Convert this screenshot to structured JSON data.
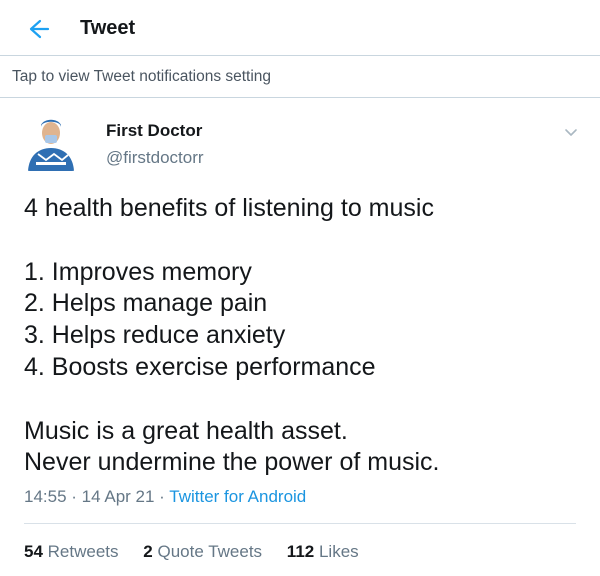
{
  "header": {
    "title": "Tweet",
    "back_icon": "back-arrow-icon",
    "accent_color": "#1da1f2"
  },
  "notification_bar": {
    "text": "Tap to view Tweet notifications setting"
  },
  "tweet": {
    "author_name": "First Doctor",
    "author_handle": "@firstdoctorr",
    "avatar_icon": "doctor-avatar",
    "menu_icon": "chevron-down-icon",
    "text": "4 health benefits of listening to music\n\n1. Improves memory\n2. Helps manage pain\n3. Helps reduce anxiety\n4. Boosts exercise performance\n\nMusic is a great health asset.\nNever undermine the power of music.",
    "time": "14:55",
    "separator": " · ",
    "date": "14 Apr 21",
    "source": "Twitter for Android",
    "source_color": "#1b95e0"
  },
  "stats": {
    "retweets_count": "54",
    "retweets_label": "Retweets",
    "quote_tweets_count": "2",
    "quote_tweets_label": "Quote Tweets",
    "likes_count": "112",
    "likes_label": "Likes"
  }
}
